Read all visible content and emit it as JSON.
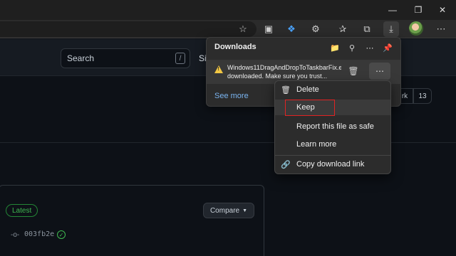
{
  "search": {
    "label": "Search",
    "shortcut": "/"
  },
  "header": {
    "nav_partial": "Si"
  },
  "downloads": {
    "title": "Downloads",
    "file_name": "Windows11DragAndDropToTaskbarFix.e",
    "message": "downloaded. Make sure you trust...",
    "see_more": "See more"
  },
  "context_menu": {
    "items": [
      {
        "label": "Delete",
        "icon": "trash-icon"
      },
      {
        "label": "Keep",
        "icon": ""
      },
      {
        "label": "Report this file as safe",
        "icon": ""
      },
      {
        "label": "Learn more",
        "icon": ""
      },
      {
        "label": "Copy download link",
        "icon": "link-icon"
      }
    ]
  },
  "pagination": {
    "partial": "rk",
    "count": "13"
  },
  "release": {
    "badge": "Latest",
    "compare": "Compare",
    "commit": "003fb2e"
  },
  "colors": {
    "accent_red": "#e02323",
    "link": "#7ab4f0",
    "green": "#3fb950",
    "warning": "#f2c744"
  }
}
